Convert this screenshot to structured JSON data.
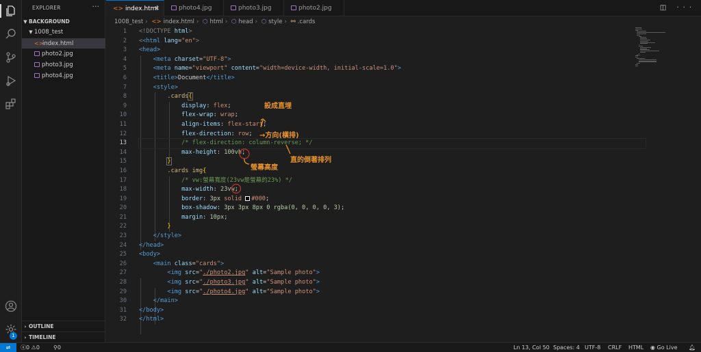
{
  "explorer": {
    "title": "EXPLORER",
    "more": "···",
    "root": "BACKGROUND",
    "folder": "1008_test",
    "files": [
      {
        "name": "index.html",
        "type": "html",
        "selected": true
      },
      {
        "name": "photo2.jpg",
        "type": "image",
        "selected": false
      },
      {
        "name": "photo3.jpg",
        "type": "image",
        "selected": false
      },
      {
        "name": "photo4.jpg",
        "type": "image",
        "selected": false
      }
    ],
    "outline": "OUTLINE",
    "timeline": "TIMELINE"
  },
  "tabs": [
    {
      "label": "index.html",
      "active": true
    },
    {
      "label": "photo4.jpg",
      "active": false
    },
    {
      "label": "photo3.jpg",
      "active": false
    },
    {
      "label": "photo2.jpg",
      "active": false
    }
  ],
  "breadcrumb": [
    "1008_test",
    "index.html",
    "html",
    "head",
    "style",
    ".cards"
  ],
  "editor": {
    "current_line": 13,
    "line_numbers": [
      "1",
      "2",
      "3",
      "4",
      "5",
      "6",
      "7",
      "8",
      "9",
      "10",
      "11",
      "12",
      "13",
      "14",
      "15",
      "16",
      "17",
      "18",
      "19",
      "20",
      "21",
      "22",
      "23",
      "24",
      "25",
      "26",
      "27",
      "28",
      "29",
      "30",
      "31",
      "32"
    ]
  },
  "code": {
    "l1": [
      "<!DOCTYPE",
      " html",
      ">"
    ],
    "l2": [
      "<html",
      " lang",
      "=",
      "\"en\"",
      ">"
    ],
    "l3": [
      "<head>"
    ],
    "l4": [
      "<meta",
      " charset",
      "=",
      "\"UTF-8\"",
      ">"
    ],
    "l5": [
      "<meta",
      " name",
      "=",
      "\"viewport\"",
      " content",
      "=",
      "\"width=device-width, initial-scale=1.0\"",
      ">"
    ],
    "l6": [
      "<title>",
      "Document",
      "</title>"
    ],
    "l7": [
      "<style>"
    ],
    "l8": [
      ".cards",
      "{"
    ],
    "l9": [
      "display",
      ": ",
      "flex",
      ";"
    ],
    "l10": [
      "flex-wrap",
      ": ",
      "wrap",
      ";"
    ],
    "l11": [
      "align-items",
      ": ",
      "flex-start",
      ";"
    ],
    "l12": [
      "flex-direction",
      ": ",
      "row",
      ";"
    ],
    "l13": [
      "/* flex-direction: column-reverse; */"
    ],
    "l14": [
      "max-height",
      ": ",
      "100vh",
      ";"
    ],
    "l15": [
      "}"
    ],
    "l16": [
      ".cards img",
      "{"
    ],
    "l17": [
      "/* vw:螢幕寬度(23vw是螢幕的23%) */"
    ],
    "l18": [
      "max-width",
      ": ",
      "23vw",
      ";"
    ],
    "l19": [
      "border",
      ": ",
      "3px",
      " solid ",
      "#000",
      ";"
    ],
    "l20": [
      "box-shadow",
      ": ",
      "3px 3px 8px 0 rgba(0, 0, 0, 0, 3)",
      ";"
    ],
    "l21": [
      "margin",
      ": ",
      "10px",
      ";"
    ],
    "l22": [
      "}"
    ],
    "l23": [
      "</style>"
    ],
    "l24": [
      "</head>"
    ],
    "l25": [
      "<body>"
    ],
    "l26": [
      "<main",
      " class",
      "=",
      "\"cards\"",
      ">"
    ],
    "l27": [
      "<img",
      " src",
      "=",
      "\"",
      "./photo2.jpg",
      "\"",
      " alt",
      "=",
      "\"Sample photo\"",
      ">"
    ],
    "l28": [
      "<img",
      " src",
      "=",
      "\"",
      "./photo3.jpg",
      "\"",
      " alt",
      "=",
      "\"Sample photo\"",
      ">"
    ],
    "l29": [
      "<img",
      " src",
      "=",
      "\"",
      "./photo4.jpg",
      "\"",
      " alt",
      "=",
      "\"Sample photo\"",
      ">"
    ],
    "l30": [
      "</main>"
    ],
    "l31": [
      "</body>"
    ],
    "l32": [
      "</html>"
    ]
  },
  "annotations": {
    "a1": "設成直埋",
    "a2": "→方向(橫排)",
    "a3": "直的倒著排列",
    "a4": "螢幕高度",
    "color": "#e8932c"
  },
  "status": {
    "errors": "0",
    "warnings": "0",
    "info": "0",
    "position": "Ln 13, Col 50",
    "spaces": "Spaces: 4",
    "encoding": "UTF-8",
    "eol": "CRLF",
    "language": "HTML",
    "golive": "Go Live",
    "notifications_badge": "1"
  }
}
